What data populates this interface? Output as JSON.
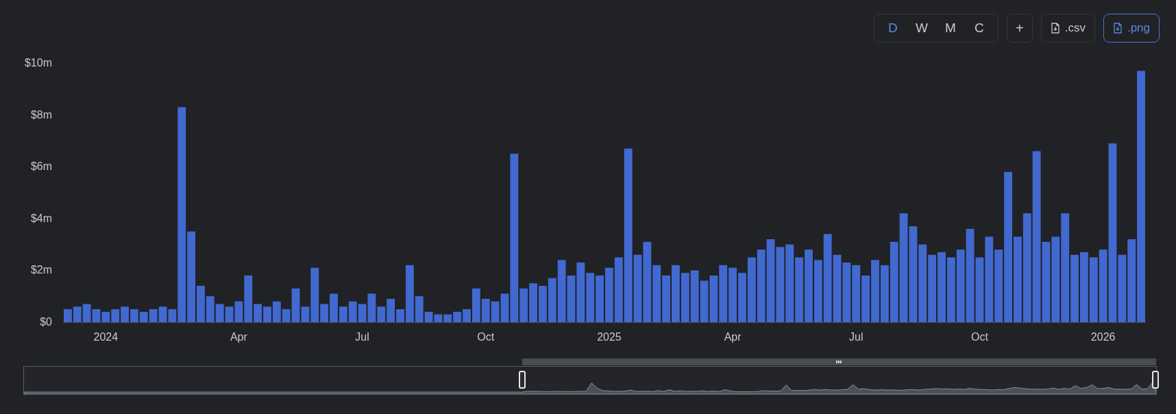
{
  "toolbar": {
    "periods": [
      {
        "label": "D",
        "selected": true
      },
      {
        "label": "W",
        "selected": false
      },
      {
        "label": "M",
        "selected": false
      },
      {
        "label": "C",
        "selected": false
      }
    ],
    "add_button": {
      "label": "+"
    },
    "exports": [
      {
        "label": ".csv",
        "active": false
      },
      {
        "label": ".png",
        "active": true
      }
    ]
  },
  "chart": {
    "chart_data": {
      "type": "bar",
      "ylim": [
        0,
        10
      ],
      "yticks": [
        {
          "value": 0,
          "label": "$0"
        },
        {
          "value": 2,
          "label": "$2m"
        },
        {
          "value": 4,
          "label": "$4m"
        },
        {
          "value": 6,
          "label": "$6m"
        },
        {
          "value": 8,
          "label": "$8m"
        },
        {
          "value": 10,
          "label": "$10m"
        }
      ],
      "categories": [
        null,
        null,
        null,
        null,
        "2024",
        null,
        null,
        null,
        null,
        null,
        null,
        null,
        null,
        null,
        null,
        null,
        null,
        null,
        "Apr",
        null,
        null,
        null,
        null,
        null,
        null,
        null,
        null,
        null,
        null,
        null,
        null,
        "Jul",
        null,
        null,
        null,
        null,
        null,
        null,
        null,
        null,
        null,
        null,
        null,
        null,
        "Oct",
        null,
        null,
        null,
        null,
        null,
        null,
        null,
        null,
        null,
        null,
        null,
        null,
        "2025",
        null,
        null,
        null,
        null,
        null,
        null,
        null,
        null,
        null,
        null,
        null,
        null,
        "Apr",
        null,
        null,
        null,
        null,
        null,
        null,
        null,
        null,
        null,
        null,
        null,
        null,
        "Jul",
        null,
        null,
        null,
        null,
        null,
        null,
        null,
        null,
        null,
        null,
        null,
        null,
        "Oct",
        null,
        null,
        null,
        null,
        null,
        null,
        null,
        null,
        null,
        null,
        null,
        null,
        "2026",
        null,
        null,
        null,
        null
      ],
      "series": [
        {
          "color": "#4169d0",
          "values": [
            0.5,
            0.6,
            0.7,
            0.5,
            0.4,
            0.5,
            0.6,
            0.5,
            0.4,
            0.5,
            0.6,
            0.5,
            8.3,
            3.5,
            1.4,
            1.0,
            0.7,
            0.6,
            0.8,
            1.8,
            0.7,
            0.6,
            0.8,
            0.5,
            1.3,
            0.6,
            2.1,
            0.7,
            1.1,
            0.6,
            0.8,
            0.7,
            1.1,
            0.6,
            0.9,
            0.5,
            2.2,
            1.0,
            0.4,
            0.3,
            0.3,
            0.4,
            0.5,
            1.3,
            0.9,
            0.8,
            1.1,
            6.5,
            1.3,
            1.5,
            1.4,
            1.7,
            2.4,
            1.8,
            2.3,
            1.9,
            1.8,
            2.1,
            2.5,
            6.7,
            2.6,
            3.1,
            2.2,
            1.8,
            2.2,
            1.9,
            2.0,
            1.6,
            1.8,
            2.2,
            2.1,
            1.9,
            2.5,
            2.8,
            3.2,
            2.9,
            3.0,
            2.5,
            2.8,
            2.4,
            3.4,
            2.6,
            2.3,
            2.2,
            1.8,
            2.4,
            2.2,
            3.1,
            4.2,
            3.7,
            3.0,
            2.6,
            2.7,
            2.5,
            2.8,
            3.6,
            2.5,
            3.3,
            2.8,
            5.8,
            3.3,
            4.2,
            6.6,
            3.1,
            3.3,
            4.2,
            2.6,
            2.7,
            2.5,
            2.8,
            6.9,
            2.6,
            3.2,
            9.7
          ]
        }
      ]
    }
  },
  "navigator": {
    "kind": "brush"
  }
}
